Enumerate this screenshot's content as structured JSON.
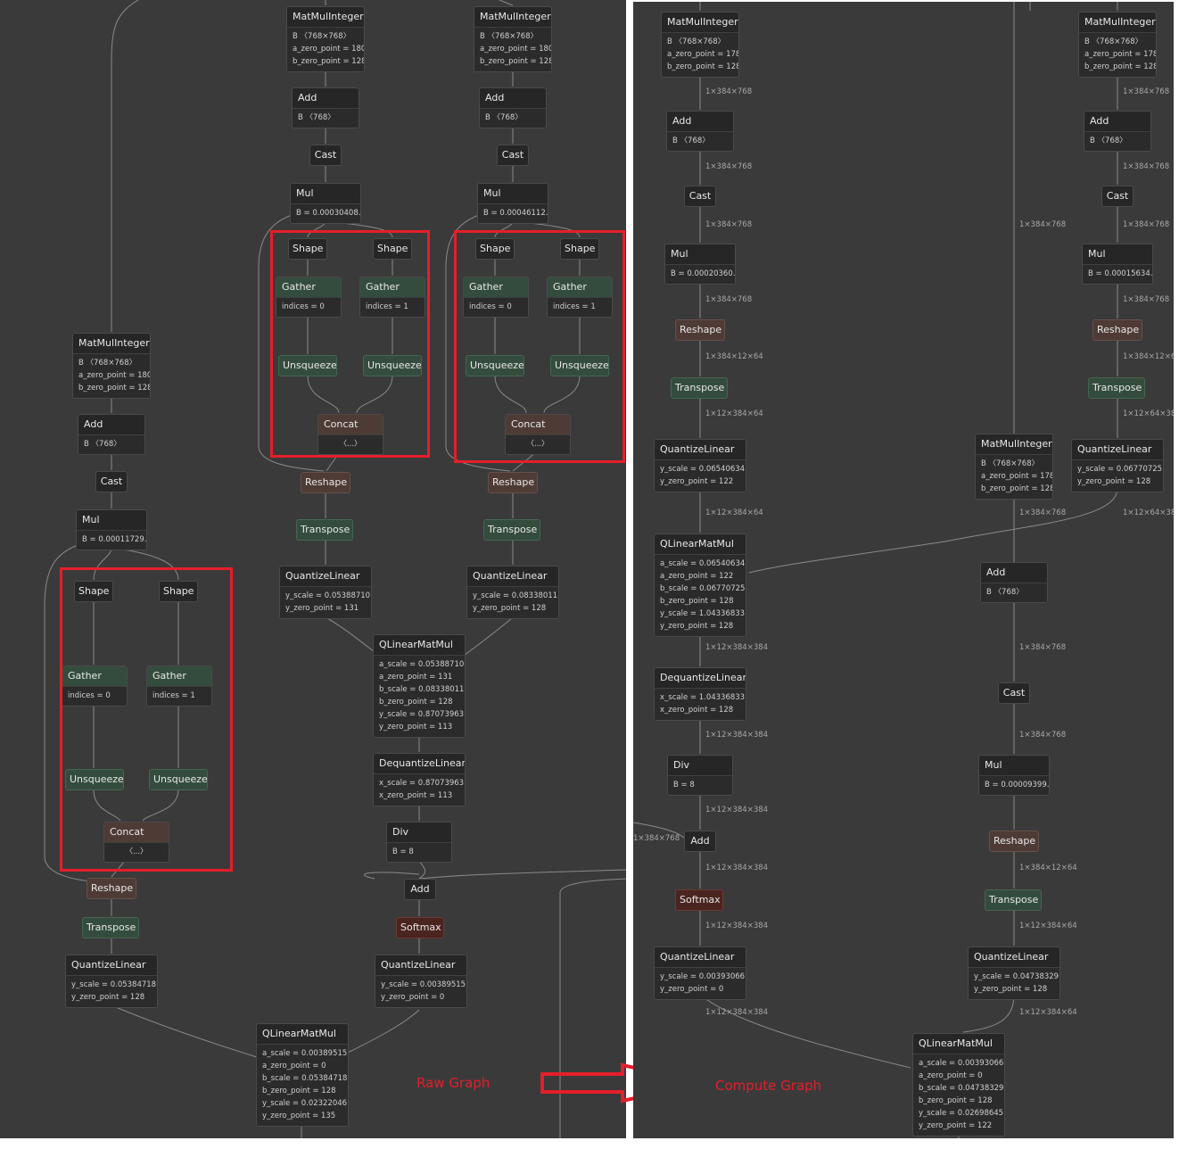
{
  "raw_graph": {
    "caption": "Raw Graph",
    "nodes": {
      "mm_q": {
        "op": "MatMulInteger",
        "attrs": [
          "B 〈768×768〉",
          "a_zero_point = 180",
          "b_zero_point = 128"
        ]
      },
      "mm_k": {
        "op": "MatMulInteger",
        "attrs": [
          "B 〈768×768〉",
          "a_zero_point = 180",
          "b_zero_point = 128"
        ]
      },
      "mm_v": {
        "op": "MatMulInteger",
        "attrs": [
          "B 〈768×768〉",
          "a_zero_point = 180",
          "b_zero_point = 128"
        ]
      },
      "add_q": {
        "op": "Add",
        "attrs": [
          "B 〈768〉"
        ]
      },
      "add_k": {
        "op": "Add",
        "attrs": [
          "B 〈768〉"
        ]
      },
      "add_v": {
        "op": "Add",
        "attrs": [
          "B 〈768〉"
        ]
      },
      "cast_q": {
        "op": "Cast"
      },
      "cast_k": {
        "op": "Cast"
      },
      "cast_v": {
        "op": "Cast"
      },
      "mul_q": {
        "op": "Mul",
        "attrs": [
          "B = 0.00030408…"
        ]
      },
      "mul_k": {
        "op": "Mul",
        "attrs": [
          "B = 0.00046112…"
        ]
      },
      "mul_v": {
        "op": "Mul",
        "attrs": [
          "B = 0.00011729…"
        ]
      },
      "shape_q0": {
        "op": "Shape"
      },
      "shape_q1": {
        "op": "Shape"
      },
      "shape_k0": {
        "op": "Shape"
      },
      "shape_k1": {
        "op": "Shape"
      },
      "shape_v0": {
        "op": "Shape"
      },
      "shape_v1": {
        "op": "Shape"
      },
      "gather_q0": {
        "op": "Gather",
        "attrs": [
          "indices = 0"
        ]
      },
      "gather_q1": {
        "op": "Gather",
        "attrs": [
          "indices = 1"
        ]
      },
      "gather_k0": {
        "op": "Gather",
        "attrs": [
          "indices = 0"
        ]
      },
      "gather_k1": {
        "op": "Gather",
        "attrs": [
          "indices = 1"
        ]
      },
      "gather_v0": {
        "op": "Gather",
        "attrs": [
          "indices = 0"
        ]
      },
      "gather_v1": {
        "op": "Gather",
        "attrs": [
          "indices = 1"
        ]
      },
      "unsq_q0": {
        "op": "Unsqueeze"
      },
      "unsq_q1": {
        "op": "Unsqueeze"
      },
      "unsq_k0": {
        "op": "Unsqueeze"
      },
      "unsq_k1": {
        "op": "Unsqueeze"
      },
      "unsq_v0": {
        "op": "Unsqueeze"
      },
      "unsq_v1": {
        "op": "Unsqueeze"
      },
      "concat_q": {
        "op": "Concat",
        "attrs": [
          "〈...〉"
        ]
      },
      "concat_k": {
        "op": "Concat",
        "attrs": [
          "〈...〉"
        ]
      },
      "concat_v": {
        "op": "Concat",
        "attrs": [
          "〈...〉"
        ]
      },
      "reshape_q": {
        "op": "Reshape"
      },
      "reshape_k": {
        "op": "Reshape"
      },
      "reshape_v": {
        "op": "Reshape"
      },
      "transpose_q": {
        "op": "Transpose"
      },
      "transpose_k": {
        "op": "Transpose"
      },
      "transpose_v": {
        "op": "Transpose"
      },
      "ql_q": {
        "op": "QuantizeLinear",
        "attrs": [
          "y_scale = 0.05388710…",
          "y_zero_point = 131"
        ]
      },
      "ql_k": {
        "op": "QuantizeLinear",
        "attrs": [
          "y_scale = 0.08338011…",
          "y_zero_point = 128"
        ]
      },
      "ql_v": {
        "op": "QuantizeLinear",
        "attrs": [
          "y_scale = 0.05384718…",
          "y_zero_point = 128"
        ]
      },
      "qlmm_qk": {
        "op": "QLinearMatMul",
        "attrs": [
          "a_scale = 0.05388710…",
          "a_zero_point = 131",
          "b_scale = 0.08338011…",
          "b_zero_point = 128",
          "y_scale = 0.87073963…",
          "y_zero_point = 113"
        ]
      },
      "dql": {
        "op": "DequantizeLinear",
        "attrs": [
          "x_scale = 0.87073963…",
          "x_zero_point = 113"
        ]
      },
      "div": {
        "op": "Div",
        "attrs": [
          "B = 8"
        ]
      },
      "add_mask": {
        "op": "Add"
      },
      "softmax": {
        "op": "Softmax"
      },
      "ql_sm": {
        "op": "QuantizeLinear",
        "attrs": [
          "y_scale = 0.00389515…",
          "y_zero_point = 0"
        ]
      },
      "qlmm_av": {
        "op": "QLinearMatMul",
        "attrs": [
          "a_scale = 0.00389515…",
          "a_zero_point = 0",
          "b_scale = 0.05384718…",
          "b_zero_point = 128",
          "y_scale = 0.02322046…",
          "y_zero_point = 135"
        ]
      }
    }
  },
  "compute_graph": {
    "caption": "Compute Graph",
    "nodes": {
      "mm_a": {
        "op": "MatMulInteger",
        "attrs": [
          "B 〈768×768〉",
          "a_zero_point = 178",
          "b_zero_point = 128"
        ]
      },
      "mm_b": {
        "op": "MatMulInteger",
        "attrs": [
          "B 〈768×768〉",
          "a_zero_point = 178",
          "b_zero_point = 128"
        ]
      },
      "mm_c": {
        "op": "MatMulInteger",
        "attrs": [
          "B 〈768×768〉",
          "a_zero_point = 178",
          "b_zero_point = 128"
        ]
      },
      "add_a": {
        "op": "Add",
        "attrs": [
          "B 〈768〉"
        ]
      },
      "add_b": {
        "op": "Add",
        "attrs": [
          "B 〈768〉"
        ]
      },
      "add_c": {
        "op": "Add",
        "attrs": [
          "B 〈768〉"
        ]
      },
      "cast_a": {
        "op": "Cast"
      },
      "cast_b": {
        "op": "Cast"
      },
      "cast_c": {
        "op": "Cast"
      },
      "mul_a": {
        "op": "Mul",
        "attrs": [
          "B = 0.00020360…"
        ]
      },
      "mul_b": {
        "op": "Mul",
        "attrs": [
          "B = 0.00015634…"
        ]
      },
      "mul_c": {
        "op": "Mul",
        "attrs": [
          "B = 0.00009399…"
        ]
      },
      "reshape_a": {
        "op": "Reshape"
      },
      "reshape_b": {
        "op": "Reshape"
      },
      "reshape_c": {
        "op": "Reshape"
      },
      "transpose_a": {
        "op": "Transpose"
      },
      "transpose_b": {
        "op": "Transpose"
      },
      "transpose_c": {
        "op": "Transpose"
      },
      "ql_a": {
        "op": "QuantizeLinear",
        "attrs": [
          "y_scale = 0.06540634…",
          "y_zero_point = 122"
        ]
      },
      "ql_b": {
        "op": "QuantizeLinear",
        "attrs": [
          "y_scale = 0.06770725…",
          "y_zero_point = 128"
        ]
      },
      "ql_c": {
        "op": "QuantizeLinear",
        "attrs": [
          "y_scale = 0.04738329…",
          "y_zero_point = 128"
        ]
      },
      "qlmm_1": {
        "op": "QLinearMatMul",
        "attrs": [
          "a_scale = 0.06540634…",
          "a_zero_point = 122",
          "b_scale = 0.06770725…",
          "b_zero_point = 128",
          "y_scale = 1.04336833…",
          "y_zero_point = 128"
        ]
      },
      "dql": {
        "op": "DequantizeLinear",
        "attrs": [
          "x_scale = 1.04336833…",
          "x_zero_point = 128"
        ]
      },
      "div": {
        "op": "Div",
        "attrs": [
          "B = 8"
        ]
      },
      "add_mask": {
        "op": "Add"
      },
      "softmax": {
        "op": "Softmax"
      },
      "ql_sm": {
        "op": "QuantizeLinear",
        "attrs": [
          "y_scale = 0.00393066…",
          "y_zero_point = 0"
        ]
      },
      "qlmm_2": {
        "op": "QLinearMatMul",
        "attrs": [
          "a_scale = 0.00393066…",
          "a_zero_point = 0",
          "b_scale = 0.04738329…",
          "b_zero_point = 128",
          "y_scale = 0.02698645…",
          "y_zero_point = 122"
        ]
      }
    },
    "shape_labels": {
      "s1": "1×384×768",
      "s2": "1×384×768",
      "s3": "1×384×768",
      "s4": "1×384×768",
      "s5": "1×384×12×64",
      "s6": "1×12×384×64",
      "s7": "1×12×384×64",
      "s8": "1×384×768",
      "s9": "1×384×768",
      "s10": "1×384×768",
      "s11": "1×384×768",
      "s12": "1×384×12×64",
      "s13": "1×12×64×384",
      "s14": "1×12×64×384",
      "s15": "1×384×768",
      "s16": "1×384×768",
      "s17": "1×384×768",
      "s18": "1×12×384×384",
      "s19": "1×12×384×384",
      "s20": "1×12×384×384",
      "s21": "1×384×768",
      "s22": "1×12×384×384",
      "s23": "1×12×384×384",
      "s24": "1×384×768",
      "s25": "1×384×12×64",
      "s26": "1×12×384×64",
      "s27": "1×12×384×64",
      "s28": "1×384×768"
    }
  },
  "colors": {
    "panel_background": "#3a3a3a",
    "node_background": "#262626",
    "green_node": "#344c3d",
    "brown_node": "#4e3b36",
    "softmax_node": "#4a2520",
    "edge": "#8a8a8a",
    "highlight_red": "#e51e2a"
  }
}
